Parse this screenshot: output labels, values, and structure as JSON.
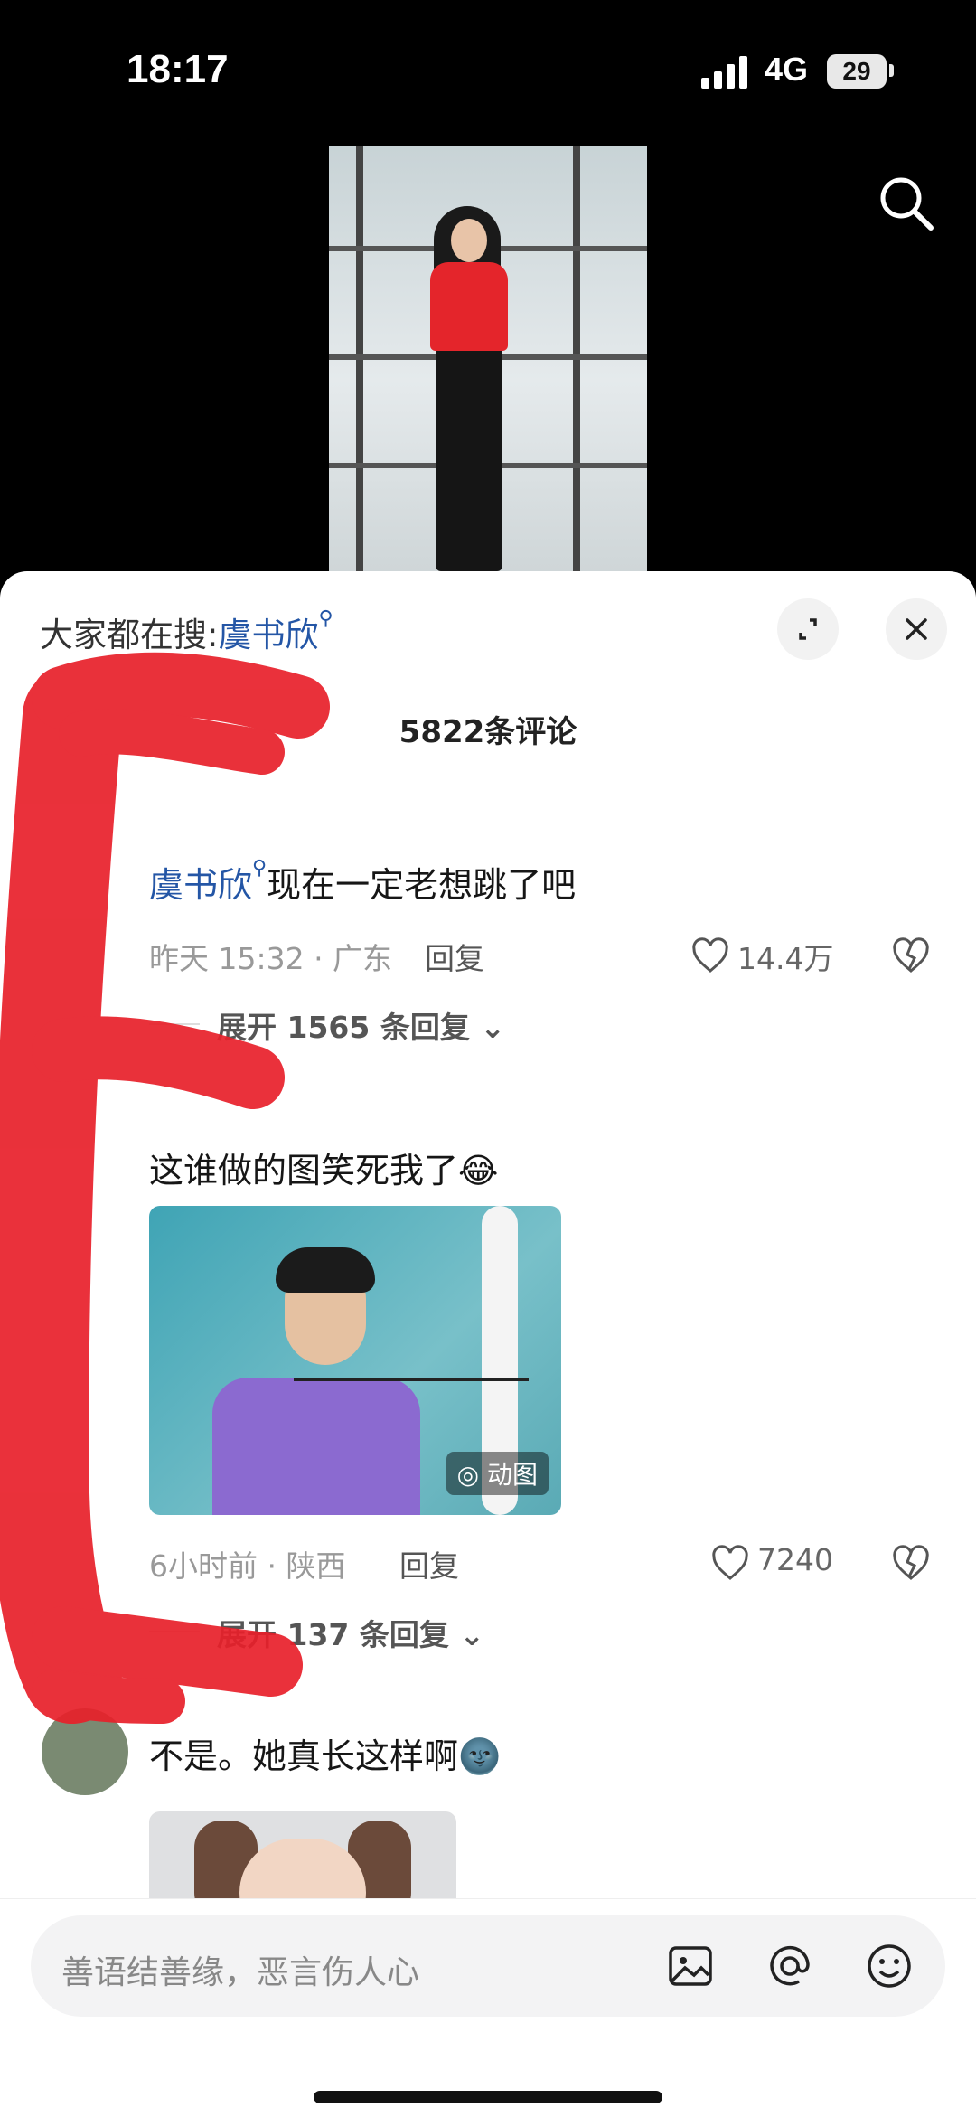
{
  "status_bar": {
    "time": "18:17",
    "network": "4G",
    "battery": "29"
  },
  "header": {
    "hot_search_prefix": "大家都在搜:",
    "hot_search_keyword": "虞书欣",
    "comment_count": "5822条评论"
  },
  "comments": [
    {
      "mention": "虞书欣",
      "text": "现在一定老想跳了吧",
      "time_location": "昨天 15:32 · 广东",
      "reply_label": "回复",
      "likes": "14.4万",
      "expand_label": "展开 1565 条回复"
    },
    {
      "text": "这谁做的图笑死我了",
      "emoji": "😂",
      "image_badge": "动图",
      "time_location": "6小时前 · 陕西",
      "reply_label": "回复",
      "likes": "7240",
      "expand_label": "展开 137 条回复"
    },
    {
      "text": "不是。她真长这样啊",
      "emoji": "🌚"
    }
  ],
  "input": {
    "placeholder": "善语结善缘，恶言伤人心"
  },
  "icons": [
    "search-icon",
    "expand-icon",
    "close-icon",
    "heart-icon",
    "dislike-icon",
    "chevron-down-icon",
    "image-icon",
    "at-icon",
    "emoji-icon"
  ],
  "colors": {
    "mention": "#2456a6",
    "scribble": "#e8202a"
  }
}
